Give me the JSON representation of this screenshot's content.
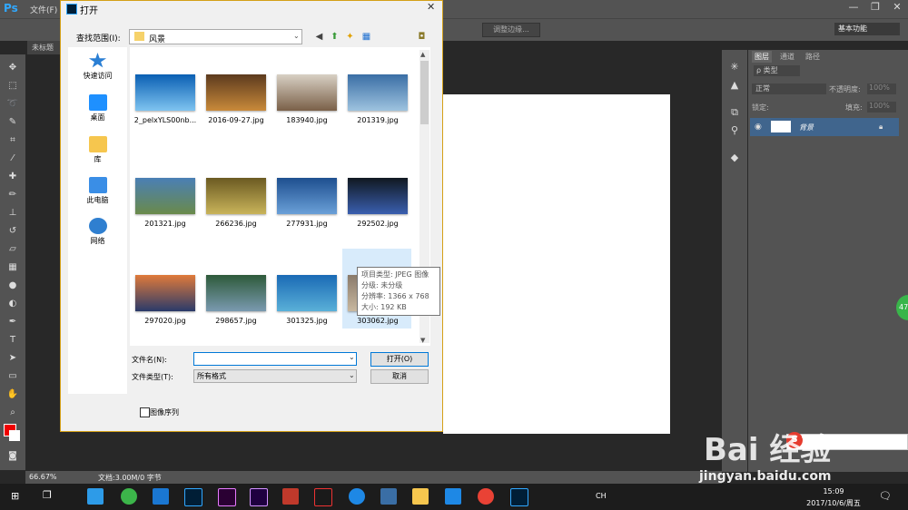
{
  "app": {
    "logo": "Ps",
    "menu_first": "文件(F)",
    "window_controls": [
      "—",
      "❐",
      "✕"
    ],
    "options_bar": {
      "refine_edge": "调整边缘...",
      "workspace": "基本功能"
    },
    "doc_tab": "未标题",
    "status": {
      "zoom": "66.67%",
      "doc": "文档:3.00M/0 字节"
    }
  },
  "layers_panel": {
    "tabs": [
      "图层",
      "通道",
      "路径"
    ],
    "filter_label": "ρ 类型",
    "blend_mode": "正常",
    "opacity_label": "不透明度:",
    "opacity_value": "100%",
    "lock_label": "锁定:",
    "fill_label": "填充:",
    "fill_value": "100%",
    "layer_name": "背景"
  },
  "dialog": {
    "title": "打开",
    "lookin_label": "查找范围(I):",
    "lookin_value": "风景",
    "places": [
      {
        "label": "快速访问",
        "icon": "star-icon",
        "color": "#2a7fd4"
      },
      {
        "label": "桌面",
        "icon": "desktop-icon",
        "color": "#1e90ff"
      },
      {
        "label": "库",
        "icon": "library-icon",
        "color": "#f6c64e"
      },
      {
        "label": "此电脑",
        "icon": "computer-icon",
        "color": "#3a8ee6"
      },
      {
        "label": "网络",
        "icon": "network-icon",
        "color": "#2f7fd0"
      }
    ],
    "files": [
      {
        "name": "2_pelxYLS00nb...",
        "c1": "#0a5fb3",
        "c2": "#7fc4f0"
      },
      {
        "name": "2016-09-27.jpg",
        "c1": "#5c3a1e",
        "c2": "#c98a3a"
      },
      {
        "name": "183940.jpg",
        "c1": "#d8d0c4",
        "c2": "#7a6048"
      },
      {
        "name": "201319.jpg",
        "c1": "#3a6ea5",
        "c2": "#9ec3df"
      },
      {
        "name": "201321.jpg",
        "c1": "#4a7fb5",
        "c2": "#6a8a4a"
      },
      {
        "name": "266236.jpg",
        "c1": "#6b5a22",
        "c2": "#c9b45a"
      },
      {
        "name": "277931.jpg",
        "c1": "#1e4f8f",
        "c2": "#6aa0d8"
      },
      {
        "name": "292502.jpg",
        "c1": "#101820",
        "c2": "#3a5fb0"
      },
      {
        "name": "297020.jpg",
        "c1": "#e07a3a",
        "c2": "#2a3a6a"
      },
      {
        "name": "298657.jpg",
        "c1": "#2e5a3a",
        "c2": "#7a9ab0"
      },
      {
        "name": "301325.jpg",
        "c1": "#1a6ab5",
        "c2": "#5ab0d8"
      },
      {
        "name": "303062.jpg",
        "c1": "#8a7a6a",
        "c2": "#c8b8a0"
      }
    ],
    "tooltip": [
      "项目类型: JPEG 图像",
      "分级: 未分级",
      "分辨率: 1366 x 768",
      "大小: 192 KB"
    ],
    "filename_label": "文件名(N):",
    "filename_value": "",
    "filetype_label": "文件类型(T):",
    "filetype_value": "所有格式",
    "open_button": "打开(O)",
    "cancel_button": "取消",
    "sequence_label": "图像序列"
  },
  "taskbar": {
    "ime": "CH",
    "time": "15:09",
    "date": "2017/10/6/周五"
  },
  "watermark": {
    "logo": "Bai 经验",
    "url": "jingyan.baidu.com"
  },
  "side_badge": "47"
}
